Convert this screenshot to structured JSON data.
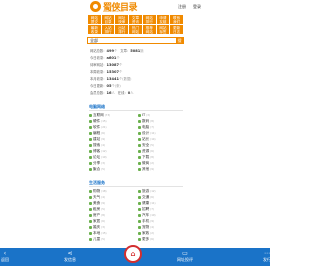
{
  "logo": {
    "text": "蜀侠目录",
    "sub": "www.shuxia.com"
  },
  "header": {
    "login": "注册",
    "register": "登录"
  },
  "nav": [
    {
      "label": "网站",
      "sub": "提交"
    },
    {
      "label": "网站",
      "sub": "目录"
    },
    {
      "label": "网址",
      "sub": "快审"
    },
    {
      "label": "文章",
      "sub": "资讯"
    },
    {
      "label": "网站",
      "sub": "排行"
    },
    {
      "label": "申请",
      "sub": "友链"
    },
    {
      "label": "联系",
      "sub": "我们"
    },
    {
      "label": "最新",
      "sub": "收录"
    },
    {
      "label": "入站",
      "sub": "排行"
    },
    {
      "label": "出站",
      "sub": "排行"
    },
    {
      "label": "热门",
      "sub": "网站"
    },
    {
      "label": "推荐",
      "sub": "网站"
    },
    {
      "label": "网站",
      "sub": "标签"
    },
    {
      "label": "更新",
      "sub": "日志"
    }
  ],
  "search": {
    "select": "全部",
    "button": "搜"
  },
  "stats": [
    {
      "label": "网站总数：",
      "value": "499",
      "unit": "个",
      "extra_label": "文章：",
      "extra_value": "5081",
      "extra_unit": "篇"
    },
    {
      "label": "今日收录：",
      "value": "a601",
      "unit": "个"
    },
    {
      "label": "待审网站：",
      "value": "13087",
      "unit": "个"
    },
    {
      "label": "本周收录：",
      "value": "15307",
      "unit": "个"
    },
    {
      "label": "本月收录：",
      "value": "13441",
      "unit": "个(数据)"
    },
    {
      "label": "今日更新：",
      "value": "05",
      "unit": "个(条)"
    },
    {
      "label": "会员总数：",
      "value": "16",
      "unit": "人",
      "extra_label": "在线：",
      "extra_value": "0",
      "extra_unit": "人"
    }
  ],
  "sections": [
    {
      "title": "电脑网络",
      "items": [
        {
          "name": "互联网",
          "count": "(73)"
        },
        {
          "name": "IT",
          "count": "(3)"
        },
        {
          "name": "硬件",
          "count": "(15)"
        },
        {
          "name": "数码",
          "count": "(8)"
        },
        {
          "name": "软件",
          "count": "(21)"
        },
        {
          "name": "电脑",
          "count": "(7)"
        },
        {
          "name": "编程",
          "count": "(6)"
        },
        {
          "name": "设计",
          "count": "(11)"
        },
        {
          "name": "建站",
          "count": "(9)"
        },
        {
          "name": "站长",
          "count": "(14)"
        },
        {
          "name": "搜索",
          "count": "(4)"
        },
        {
          "name": "安全",
          "count": "(5)"
        },
        {
          "name": "博客",
          "count": "(12)"
        },
        {
          "name": "资源",
          "count": "(6)"
        },
        {
          "name": "论坛",
          "count": "(10)"
        },
        {
          "name": "下载",
          "count": "(8)"
        },
        {
          "name": "分享",
          "count": "(3)"
        },
        {
          "name": "微商",
          "count": "(2)"
        },
        {
          "name": "聚合",
          "count": "(5)"
        },
        {
          "name": "其他",
          "count": "(9)"
        }
      ]
    },
    {
      "title": "生活服务",
      "items": [
        {
          "name": "购物",
          "count": "(18)"
        },
        {
          "name": "旅游",
          "count": "(12)"
        },
        {
          "name": "天气",
          "count": "(4)"
        },
        {
          "name": "交通",
          "count": "(6)"
        },
        {
          "name": "美食",
          "count": "(9)"
        },
        {
          "name": "健康",
          "count": "(11)"
        },
        {
          "name": "租房",
          "count": "(5)"
        },
        {
          "name": "招聘",
          "count": "(7)"
        },
        {
          "name": "房产",
          "count": "(8)"
        },
        {
          "name": "汽车",
          "count": "(10)"
        },
        {
          "name": "家居",
          "count": "(6)"
        },
        {
          "name": "手机",
          "count": "(9)"
        },
        {
          "name": "婚庆",
          "count": "(3)"
        },
        {
          "name": "宠物",
          "count": "(4)"
        },
        {
          "name": "本地",
          "count": "(15)"
        },
        {
          "name": "家政",
          "count": "(2)"
        },
        {
          "name": "儿童",
          "count": "(5)"
        },
        {
          "name": "更多",
          "count": "(6)"
        }
      ]
    }
  ],
  "bottom": {
    "left": "返回",
    "publish": "发信息",
    "home": "首页",
    "online": "网址投评",
    "right": "发行"
  }
}
